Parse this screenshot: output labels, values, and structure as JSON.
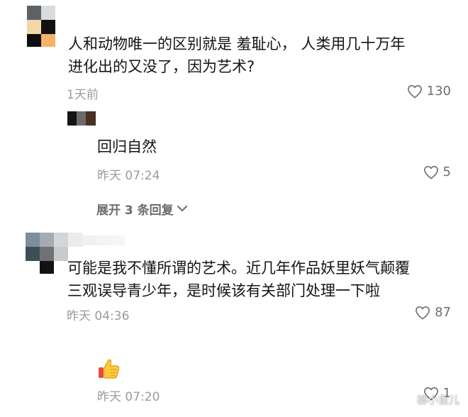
{
  "comments": [
    {
      "text_lines": [
        "人和动物唯一的区别就是 羞耻心， 人类用几十万年",
        "进化出的又没了，因为艺术?"
      ],
      "time": "1天前",
      "likes": "130",
      "replies": [
        {
          "text": "回归自然",
          "time": "昨天 07:24",
          "likes": "5"
        }
      ],
      "expand_label": "展开 3 条回复"
    },
    {
      "text_lines": [
        "可能是我不懂所谓的艺术。近几年作品妖里妖气颠覆",
        "三观误导青少年，是时候该有关部门处理一下啦"
      ],
      "time": "昨天 04:36",
      "likes": "87",
      "replies": [
        {
          "emoji": "thumbs-up",
          "time": "昨天 07:20",
          "likes": "1"
        }
      ]
    }
  ],
  "icons": {
    "like": "heart-outline-icon",
    "expand": "chevron-down-icon",
    "reaction": "thumbs-up-emoji"
  },
  "watermark": "柳小鱼儿"
}
